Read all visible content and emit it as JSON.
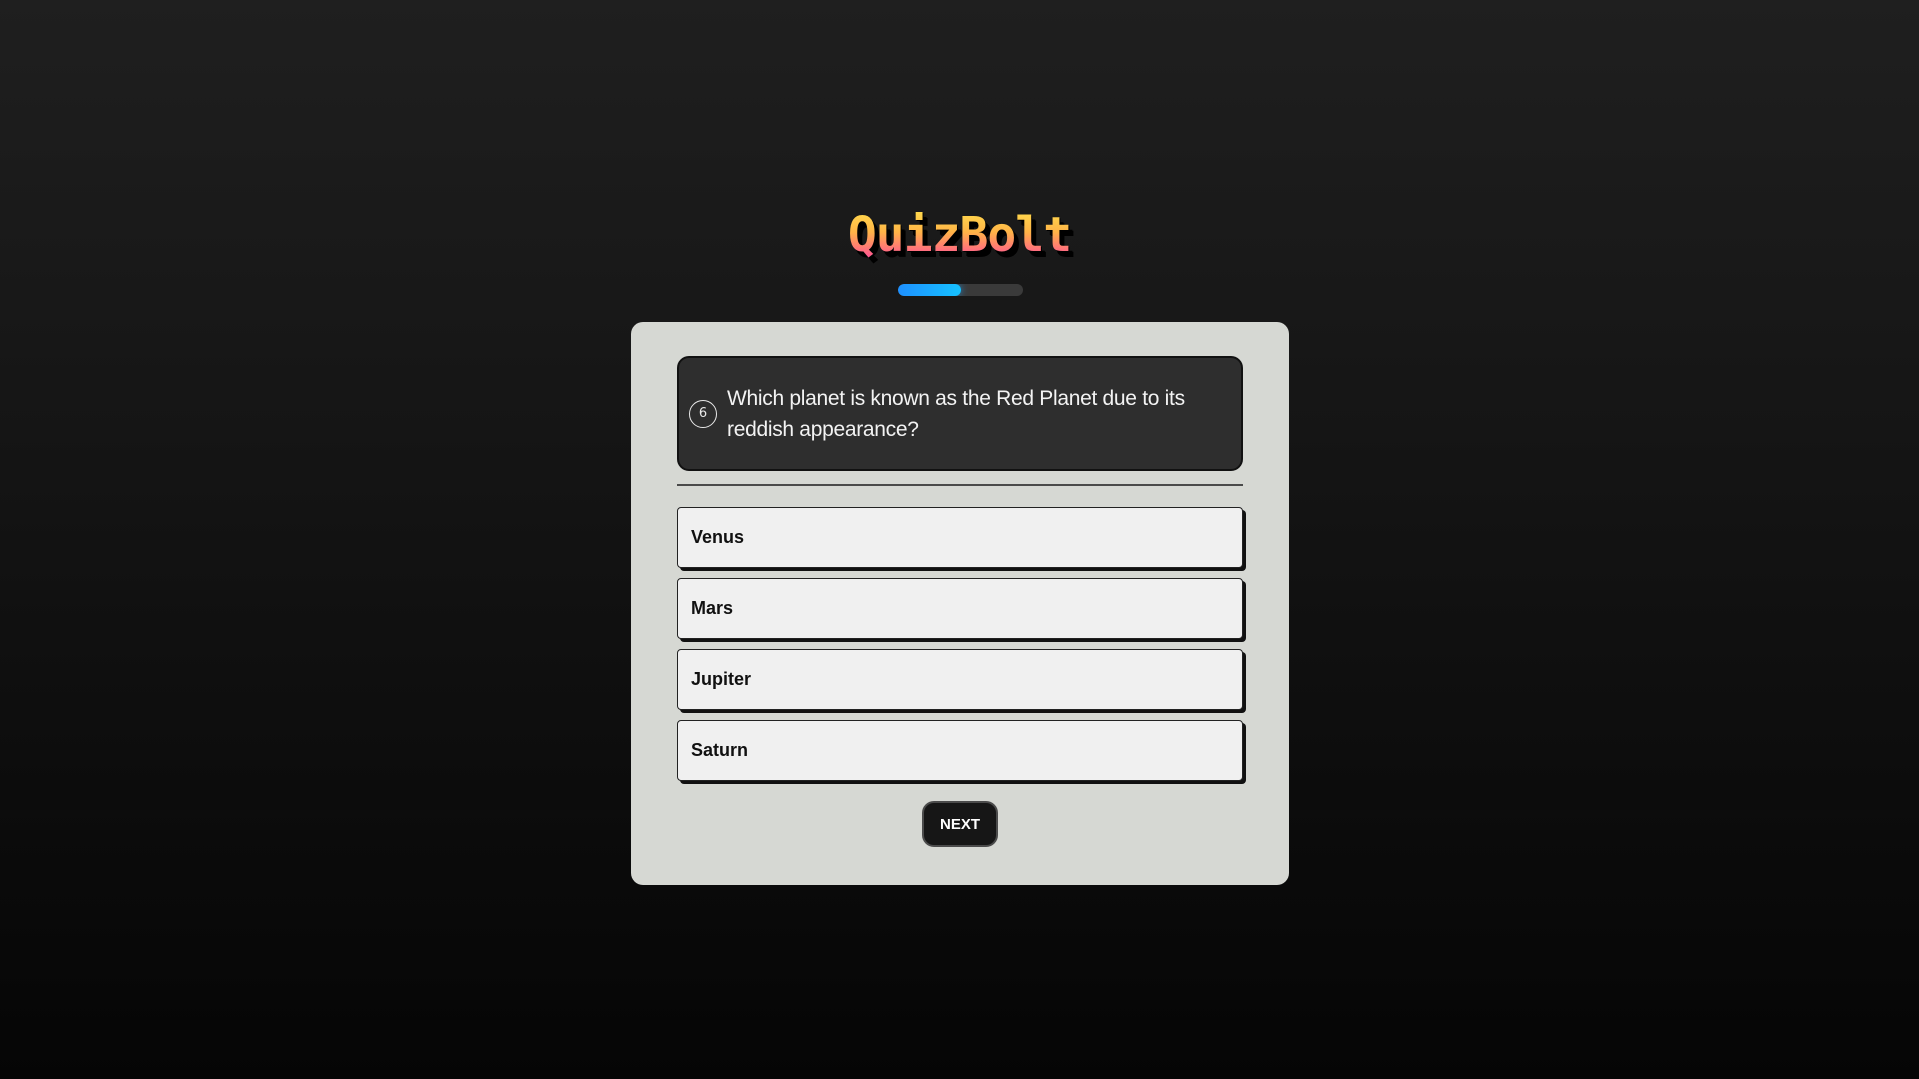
{
  "app": {
    "logo_text": "QuizBolt"
  },
  "progress": {
    "fraction": 0.5
  },
  "question": {
    "number": "6",
    "text": "Which planet is known as the Red Planet due to its reddish appearance?"
  },
  "answers": [
    {
      "label": "Venus"
    },
    {
      "label": "Mars"
    },
    {
      "label": "Jupiter"
    },
    {
      "label": "Saturn"
    }
  ],
  "actions": {
    "next_label": "NEXT"
  },
  "colors": {
    "background": "#1a1a1a",
    "card": "#d6d8d3",
    "question_box": "#2e2e2e",
    "answer": "#f0f0f0",
    "progress_fill": "#1e90ff",
    "progress_track": "#3a3a3a",
    "logo_gradient_top": "#ffe14d",
    "logo_gradient_bottom": "#ff3fa4"
  }
}
